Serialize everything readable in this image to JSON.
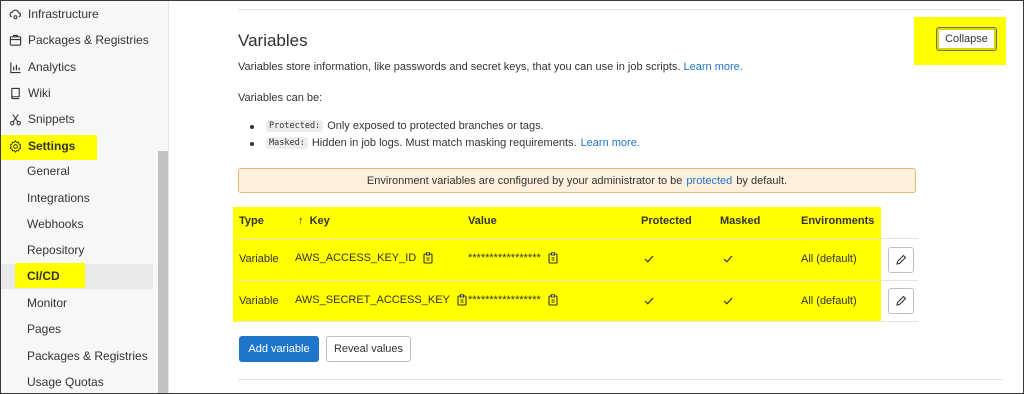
{
  "sidebar": {
    "items": [
      {
        "label": "Infrastructure",
        "icon": "cloud-gear-icon"
      },
      {
        "label": "Packages & Registries",
        "icon": "package-icon"
      },
      {
        "label": "Analytics",
        "icon": "chart-icon"
      },
      {
        "label": "Wiki",
        "icon": "book-icon"
      },
      {
        "label": "Snippets",
        "icon": "scissors-icon"
      },
      {
        "label": "Settings",
        "icon": "settings-icon"
      }
    ],
    "settings_sub": [
      {
        "label": "General"
      },
      {
        "label": "Integrations"
      },
      {
        "label": "Webhooks"
      },
      {
        "label": "Repository"
      },
      {
        "label": "CI/CD"
      },
      {
        "label": "Monitor"
      },
      {
        "label": "Pages"
      },
      {
        "label": "Packages & Registries"
      },
      {
        "label": "Usage Quotas"
      }
    ],
    "active_sub": "CI/CD"
  },
  "section": {
    "title": "Variables",
    "collapse_label": "Collapse",
    "description": "Variables store information, like passwords and secret keys, that you can use in job scripts.",
    "learn_more": "Learn more.",
    "can_be": "Variables can be:",
    "bullets": [
      {
        "code": "Protected:",
        "text": "Only exposed to protected branches or tags.",
        "link": ""
      },
      {
        "code": "Masked:",
        "text": "Hidden in job logs. Must match masking requirements.",
        "link": "Learn more."
      }
    ],
    "alert": {
      "before": "Environment variables are configured by your administrator to be",
      "link": "protected",
      "after": "by default."
    }
  },
  "table": {
    "headers": {
      "type": "Type",
      "sort_arrow": "↑",
      "key": "Key",
      "value": "Value",
      "protected": "Protected",
      "masked": "Masked",
      "environments": "Environments"
    },
    "rows": [
      {
        "type": "Variable",
        "key": "AWS_ACCESS_KEY_ID",
        "value": "*****************",
        "protected": true,
        "masked": true,
        "environments": "All (default)"
      },
      {
        "type": "Variable",
        "key": "AWS_SECRET_ACCESS_KEY",
        "value": "*****************",
        "protected": true,
        "masked": true,
        "environments": "All (default)"
      }
    ]
  },
  "actions": {
    "add_variable": "Add variable",
    "reveal_values": "Reveal values"
  },
  "colors": {
    "highlight": "#ffff00",
    "primary": "#1f75cb",
    "alert_bg": "#fdf1dd",
    "alert_border": "#e9b974"
  }
}
